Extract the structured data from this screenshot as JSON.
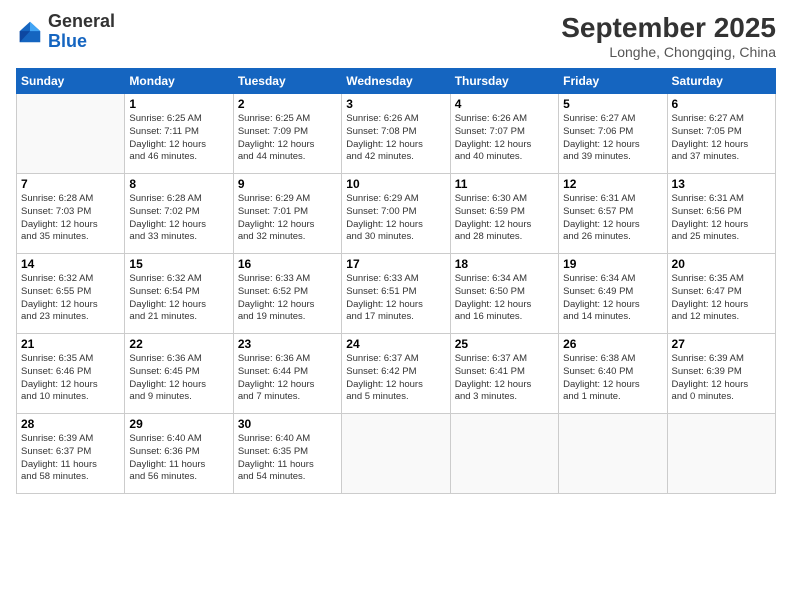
{
  "logo": {
    "general": "General",
    "blue": "Blue"
  },
  "header": {
    "month": "September 2025",
    "location": "Longhe, Chongqing, China"
  },
  "weekdays": [
    "Sunday",
    "Monday",
    "Tuesday",
    "Wednesday",
    "Thursday",
    "Friday",
    "Saturday"
  ],
  "weeks": [
    [
      {
        "day": "",
        "info": ""
      },
      {
        "day": "1",
        "info": "Sunrise: 6:25 AM\nSunset: 7:11 PM\nDaylight: 12 hours\nand 46 minutes."
      },
      {
        "day": "2",
        "info": "Sunrise: 6:25 AM\nSunset: 7:09 PM\nDaylight: 12 hours\nand 44 minutes."
      },
      {
        "day": "3",
        "info": "Sunrise: 6:26 AM\nSunset: 7:08 PM\nDaylight: 12 hours\nand 42 minutes."
      },
      {
        "day": "4",
        "info": "Sunrise: 6:26 AM\nSunset: 7:07 PM\nDaylight: 12 hours\nand 40 minutes."
      },
      {
        "day": "5",
        "info": "Sunrise: 6:27 AM\nSunset: 7:06 PM\nDaylight: 12 hours\nand 39 minutes."
      },
      {
        "day": "6",
        "info": "Sunrise: 6:27 AM\nSunset: 7:05 PM\nDaylight: 12 hours\nand 37 minutes."
      }
    ],
    [
      {
        "day": "7",
        "info": "Sunrise: 6:28 AM\nSunset: 7:03 PM\nDaylight: 12 hours\nand 35 minutes."
      },
      {
        "day": "8",
        "info": "Sunrise: 6:28 AM\nSunset: 7:02 PM\nDaylight: 12 hours\nand 33 minutes."
      },
      {
        "day": "9",
        "info": "Sunrise: 6:29 AM\nSunset: 7:01 PM\nDaylight: 12 hours\nand 32 minutes."
      },
      {
        "day": "10",
        "info": "Sunrise: 6:29 AM\nSunset: 7:00 PM\nDaylight: 12 hours\nand 30 minutes."
      },
      {
        "day": "11",
        "info": "Sunrise: 6:30 AM\nSunset: 6:59 PM\nDaylight: 12 hours\nand 28 minutes."
      },
      {
        "day": "12",
        "info": "Sunrise: 6:31 AM\nSunset: 6:57 PM\nDaylight: 12 hours\nand 26 minutes."
      },
      {
        "day": "13",
        "info": "Sunrise: 6:31 AM\nSunset: 6:56 PM\nDaylight: 12 hours\nand 25 minutes."
      }
    ],
    [
      {
        "day": "14",
        "info": "Sunrise: 6:32 AM\nSunset: 6:55 PM\nDaylight: 12 hours\nand 23 minutes."
      },
      {
        "day": "15",
        "info": "Sunrise: 6:32 AM\nSunset: 6:54 PM\nDaylight: 12 hours\nand 21 minutes."
      },
      {
        "day": "16",
        "info": "Sunrise: 6:33 AM\nSunset: 6:52 PM\nDaylight: 12 hours\nand 19 minutes."
      },
      {
        "day": "17",
        "info": "Sunrise: 6:33 AM\nSunset: 6:51 PM\nDaylight: 12 hours\nand 17 minutes."
      },
      {
        "day": "18",
        "info": "Sunrise: 6:34 AM\nSunset: 6:50 PM\nDaylight: 12 hours\nand 16 minutes."
      },
      {
        "day": "19",
        "info": "Sunrise: 6:34 AM\nSunset: 6:49 PM\nDaylight: 12 hours\nand 14 minutes."
      },
      {
        "day": "20",
        "info": "Sunrise: 6:35 AM\nSunset: 6:47 PM\nDaylight: 12 hours\nand 12 minutes."
      }
    ],
    [
      {
        "day": "21",
        "info": "Sunrise: 6:35 AM\nSunset: 6:46 PM\nDaylight: 12 hours\nand 10 minutes."
      },
      {
        "day": "22",
        "info": "Sunrise: 6:36 AM\nSunset: 6:45 PM\nDaylight: 12 hours\nand 9 minutes."
      },
      {
        "day": "23",
        "info": "Sunrise: 6:36 AM\nSunset: 6:44 PM\nDaylight: 12 hours\nand 7 minutes."
      },
      {
        "day": "24",
        "info": "Sunrise: 6:37 AM\nSunset: 6:42 PM\nDaylight: 12 hours\nand 5 minutes."
      },
      {
        "day": "25",
        "info": "Sunrise: 6:37 AM\nSunset: 6:41 PM\nDaylight: 12 hours\nand 3 minutes."
      },
      {
        "day": "26",
        "info": "Sunrise: 6:38 AM\nSunset: 6:40 PM\nDaylight: 12 hours\nand 1 minute."
      },
      {
        "day": "27",
        "info": "Sunrise: 6:39 AM\nSunset: 6:39 PM\nDaylight: 12 hours\nand 0 minutes."
      }
    ],
    [
      {
        "day": "28",
        "info": "Sunrise: 6:39 AM\nSunset: 6:37 PM\nDaylight: 11 hours\nand 58 minutes."
      },
      {
        "day": "29",
        "info": "Sunrise: 6:40 AM\nSunset: 6:36 PM\nDaylight: 11 hours\nand 56 minutes."
      },
      {
        "day": "30",
        "info": "Sunrise: 6:40 AM\nSunset: 6:35 PM\nDaylight: 11 hours\nand 54 minutes."
      },
      {
        "day": "",
        "info": ""
      },
      {
        "day": "",
        "info": ""
      },
      {
        "day": "",
        "info": ""
      },
      {
        "day": "",
        "info": ""
      }
    ]
  ]
}
